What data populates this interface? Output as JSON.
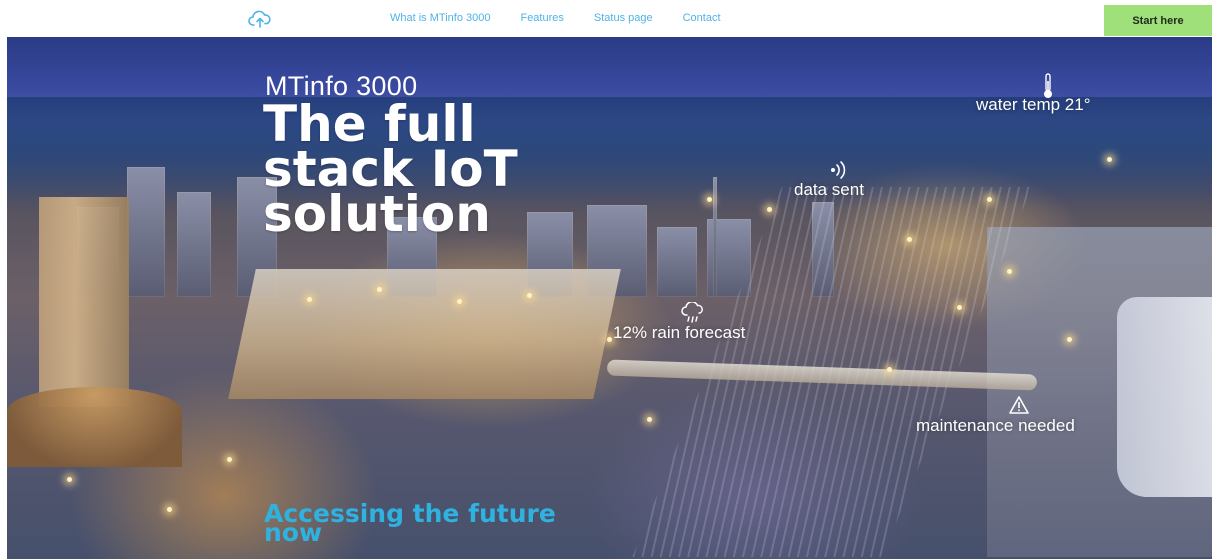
{
  "nav": {
    "logo_icon": "cloud-upload-icon",
    "links": [
      "What is MTinfo 3000",
      "Features",
      "Status page",
      "Contact"
    ],
    "cta_label": "Start here"
  },
  "hero": {
    "subtitle": "MTinfo 3000",
    "title": "The full stack IoT solution",
    "tagline": "Accessing the future now",
    "overlays": {
      "water_temp": {
        "text": "water temp 21°",
        "icon": "thermometer-icon"
      },
      "data_sent": {
        "text": "data sent",
        "icon": "wireless-signal-icon"
      },
      "rain": {
        "text": "12% rain forecast",
        "icon": "cloud-rain-icon"
      },
      "maintenance": {
        "text": "maintenance needed",
        "icon": "warning-icon"
      }
    }
  },
  "colors": {
    "nav_link": "#4fb3e6",
    "cta_bg": "#9fe07a",
    "tagline": "#2fb2e0"
  }
}
